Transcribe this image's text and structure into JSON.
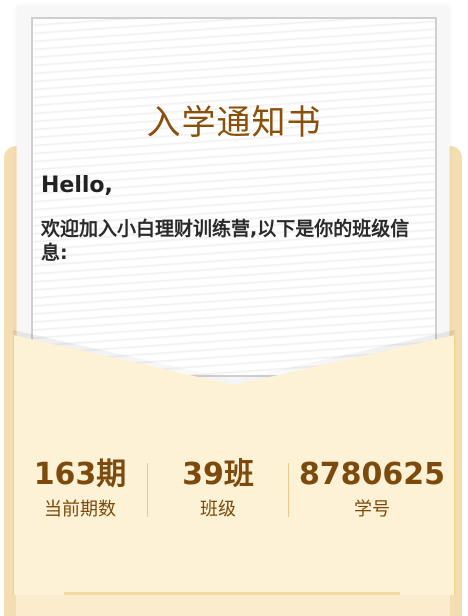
{
  "letter": {
    "title": "入学通知书",
    "greeting": "Hello,",
    "body": "欢迎加入小白理财训练营,以下是你的班级信息:"
  },
  "stats": [
    {
      "value": "163期",
      "label": "当前期数"
    },
    {
      "value": "39班",
      "label": "班级"
    },
    {
      "value": "8780625",
      "label": "学号"
    }
  ],
  "colors": {
    "title": "#8a4f0a",
    "stat_text": "#7b4a0c",
    "envelope": "#fdf1d6"
  }
}
